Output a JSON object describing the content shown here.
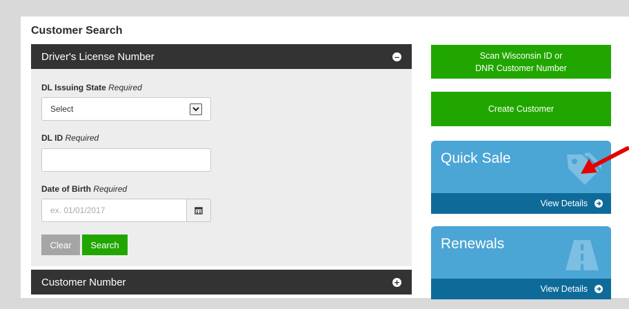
{
  "page": {
    "title": "Customer Search"
  },
  "accordion": {
    "dl_header": "Driver's License Number",
    "customer_header": "Customer Number"
  },
  "form": {
    "state_label": "DL Issuing State",
    "state_required": "Required",
    "state_value": "Select",
    "dl_label": "DL ID",
    "dl_required": "Required",
    "dl_value": "",
    "dob_label": "Date of Birth",
    "dob_required": "Required",
    "dob_placeholder": "ex. 01/01/2017",
    "clear_label": "Clear",
    "search_label": "Search"
  },
  "actions": {
    "scan_line1": "Scan Wisconsin ID or",
    "scan_line2": "DNR Customer Number",
    "create_label": "Create Customer"
  },
  "tiles": {
    "quick_sale_title": "Quick Sale",
    "quick_sale_link": "View Details",
    "renewals_title": "Renewals",
    "renewals_link": "View Details"
  },
  "colors": {
    "accordion_header": "#333333",
    "green": "#21a600",
    "tile_blue": "#4ba5d5",
    "tile_footer": "#0e6b99",
    "arrow_red": "#e60000"
  },
  "icons": {
    "minus": "minus-circle-icon",
    "plus": "plus-circle-icon",
    "calendar": "calendar-icon",
    "tag": "tag-icon",
    "road": "road-icon"
  }
}
